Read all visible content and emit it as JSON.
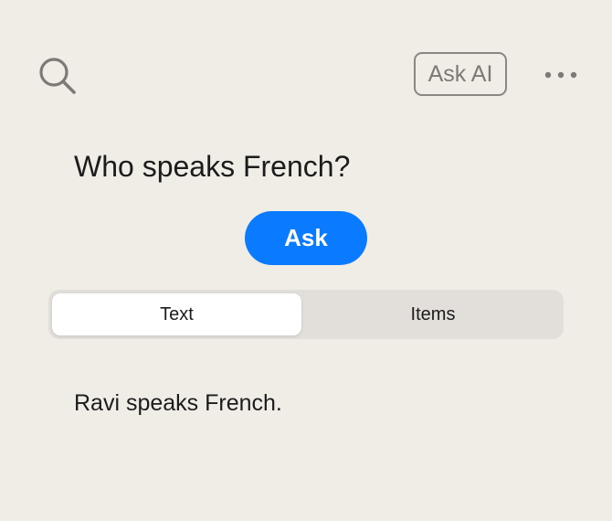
{
  "header": {
    "search_icon": "search-icon",
    "ask_ai_label": "Ask AI",
    "more_icon": "more-horizontal-icon"
  },
  "query": {
    "question": "Who speaks French?",
    "ask_label": "Ask"
  },
  "tabs": {
    "items": [
      {
        "label": "Text",
        "selected": true
      },
      {
        "label": "Items",
        "selected": false
      }
    ]
  },
  "result": {
    "answer": "Ravi speaks French."
  },
  "colors": {
    "background": "#f0ede6",
    "accent": "#0a7aff",
    "segment_bg": "#e2dfdb"
  }
}
